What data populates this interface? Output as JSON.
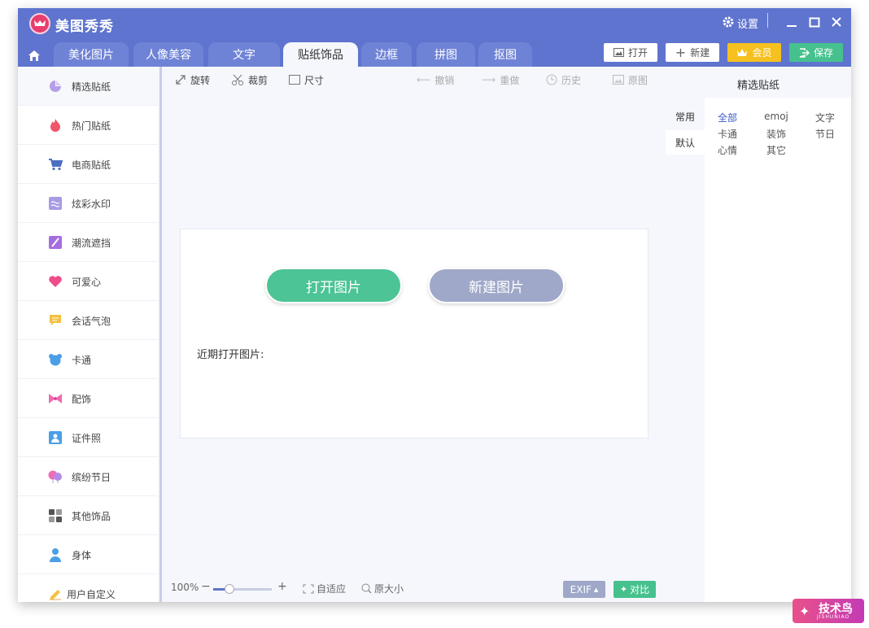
{
  "app": {
    "title": "美图秀秀",
    "settings_label": "设置"
  },
  "tabs": [
    {
      "label": "美化图片"
    },
    {
      "label": "人像美容"
    },
    {
      "label": "文字"
    },
    {
      "label": "贴纸饰品"
    },
    {
      "label": "边框"
    },
    {
      "label": "拼图"
    },
    {
      "label": "抠图"
    }
  ],
  "header_buttons": {
    "open": "打开",
    "new": "新建",
    "vip": "会员",
    "save": "保存"
  },
  "sidebar": {
    "items": [
      {
        "label": "精选贴纸",
        "icon": "sticker-icon"
      },
      {
        "label": "热门贴纸",
        "icon": "fire-icon"
      },
      {
        "label": "电商贴纸",
        "icon": "cart-icon"
      },
      {
        "label": "炫彩水印",
        "icon": "watermark-icon"
      },
      {
        "label": "潮流遮挡",
        "icon": "mask-icon"
      },
      {
        "label": "可爱心",
        "icon": "heart-icon"
      },
      {
        "label": "会话气泡",
        "icon": "chat-bubble-icon"
      },
      {
        "label": "卡通",
        "icon": "bear-icon"
      },
      {
        "label": "配饰",
        "icon": "bow-icon"
      },
      {
        "label": "证件照",
        "icon": "id-photo-icon"
      },
      {
        "label": "缤纷节日",
        "icon": "balloon-icon"
      },
      {
        "label": "其他饰品",
        "icon": "grid-icon"
      },
      {
        "label": "身体",
        "icon": "person-icon"
      },
      {
        "label": "用户自定义",
        "icon": "pencil-icon"
      }
    ]
  },
  "toolbar": {
    "rotate": "旋转",
    "crop": "裁剪",
    "size": "尺寸",
    "undo": "撤销",
    "redo": "重做",
    "history": "历史",
    "original": "原图"
  },
  "canvas": {
    "open_image": "打开图片",
    "new_image": "新建图片",
    "recent_label": "近期打开图片:"
  },
  "right_panel": {
    "title": "精选贴纸",
    "side_tabs": [
      "常用",
      "默认"
    ],
    "categories": [
      "全部",
      "emoj",
      "文字",
      "卡通",
      "装饰",
      "节日",
      "心情",
      "其它"
    ]
  },
  "bottom": {
    "zoom": "100%",
    "fit": "自适应",
    "actual_size": "原大小",
    "exif": "EXIF",
    "compare": "对比"
  },
  "watermark": {
    "text": "技术鸟",
    "sub": "JISHUNIAO"
  },
  "colors": {
    "titlebar": "#5f74cf",
    "open_btn": "#4cc495",
    "new_btn": "#9fa8c8",
    "vip": "#f6c11f",
    "save": "#46c18d"
  }
}
